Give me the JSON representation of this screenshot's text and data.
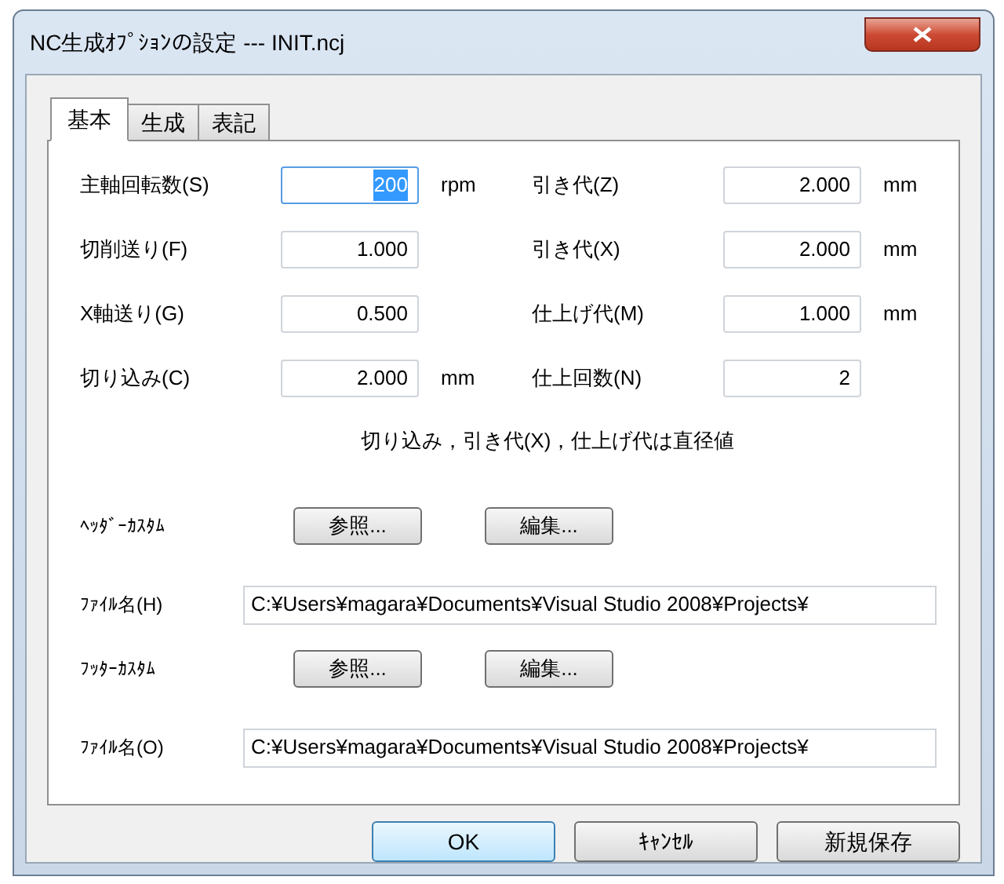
{
  "window": {
    "title": "NC生成ｵﾌﾟｼｮﾝの設定 --- INIT.ncj"
  },
  "tabs": [
    {
      "label": "基本",
      "selected": true
    },
    {
      "label": "生成",
      "selected": false
    },
    {
      "label": "表記",
      "selected": false
    }
  ],
  "fields": [
    {
      "label": "主軸回転数(S)",
      "value": "200",
      "unit": "rpm",
      "focused": true,
      "text_selected": true
    },
    {
      "label": "引き代(Z)",
      "value": "2.000",
      "unit": "mm",
      "focused": false,
      "text_selected": false
    },
    {
      "label": "切削送り(F)",
      "value": "1.000",
      "focused": false,
      "text_selected": false
    },
    {
      "label": "引き代(X)",
      "value": "2.000",
      "unit": "mm",
      "focused": false,
      "text_selected": false
    },
    {
      "label": "X軸送り(G)",
      "value": "0.500",
      "focused": false,
      "text_selected": false
    },
    {
      "label": "仕上げ代(M)",
      "value": "1.000",
      "unit": "mm",
      "focused": false,
      "text_selected": false
    },
    {
      "label": "切り込み(C)",
      "value": "2.000",
      "unit": "mm",
      "focused": false,
      "text_selected": false
    },
    {
      "label": "仕上回数(N)",
      "value": "2",
      "focused": false,
      "text_selected": false
    }
  ],
  "note": "切り込み，引き代(X)，仕上げ代は直径値",
  "custom_sections": [
    {
      "label": "ﾍｯﾀﾞｰｶｽﾀﾑ",
      "buttons": [
        "参照...",
        "編集..."
      ],
      "file_label": "ﾌｧｲﾙ名(H)",
      "file_value": "C:¥Users¥magara¥Documents¥Visual Studio 2008¥Projects¥"
    },
    {
      "label": "ﾌｯﾀｰｶｽﾀﾑ",
      "buttons": [
        "参照...",
        "編集..."
      ],
      "file_label": "ﾌｧｲﾙ名(O)",
      "file_value": "C:¥Users¥magara¥Documents¥Visual Studio 2008¥Projects¥"
    }
  ],
  "buttons": [
    {
      "label": "OK",
      "default": true
    },
    {
      "label": "ｷｬﾝｾﾙ",
      "default": false
    },
    {
      "label": "新規保存",
      "default": false
    }
  ]
}
